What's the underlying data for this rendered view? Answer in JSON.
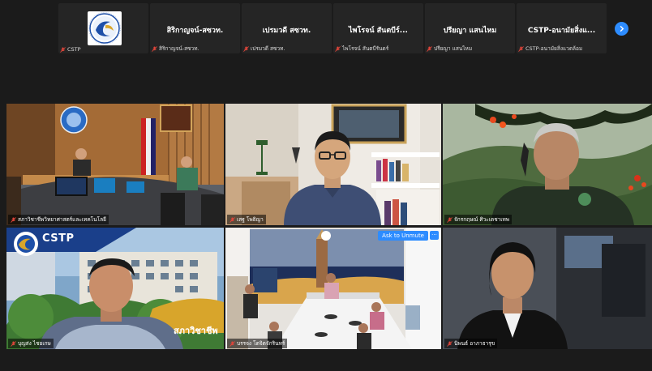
{
  "top_strip": {
    "tiles": [
      {
        "name": "",
        "label": "CSTP"
      },
      {
        "name": "สิริกาญจน์-สซวท.",
        "label": "สิริกาญจน์-สซวท."
      },
      {
        "name": "เปรมวดี สซวท.",
        "label": "เปรมวดี สซวท."
      },
      {
        "name": "ไพโรจน์ สันตบีร์...",
        "label": "ไพโรจน์ สันตบีรันดร์"
      },
      {
        "name": "ปรียญา แสนไหม",
        "label": "ปรียญา แสนไหม"
      },
      {
        "name": "CSTP-อนามัยสิ่งแ...",
        "label": "CSTP-อนามัยสิ่งแวดล้อม"
      }
    ],
    "next_icon": "chevron-right-icon"
  },
  "videos": [
    {
      "label": "สภาวิชาชีพวิทยาศาสตร์และเทคโนโลยี",
      "muted": true
    },
    {
      "label": "เสฐ โพธิญา",
      "muted": true
    },
    {
      "label": "จักรกฤษณ์ ศิวะเดชาเทพ",
      "muted": true
    },
    {
      "label": "บุญส่ง ไชยเกษ",
      "muted": true,
      "active": true,
      "banner_brand": "CSTP",
      "banner_text": "สภาวิชาชีพ"
    },
    {
      "label": "บรรจง โตจิตจักรินทร์",
      "muted": true,
      "unmute_label": "Ask to Unmute",
      "more_label": "···"
    },
    {
      "label": "นิพนธ์ อาภาธารุข",
      "muted": true
    }
  ],
  "colors": {
    "background": "#1b1b1b",
    "tile": "#252525",
    "accent": "#2d8cff",
    "active_speaker": "#b5d33a",
    "muted": "#e0453a"
  }
}
